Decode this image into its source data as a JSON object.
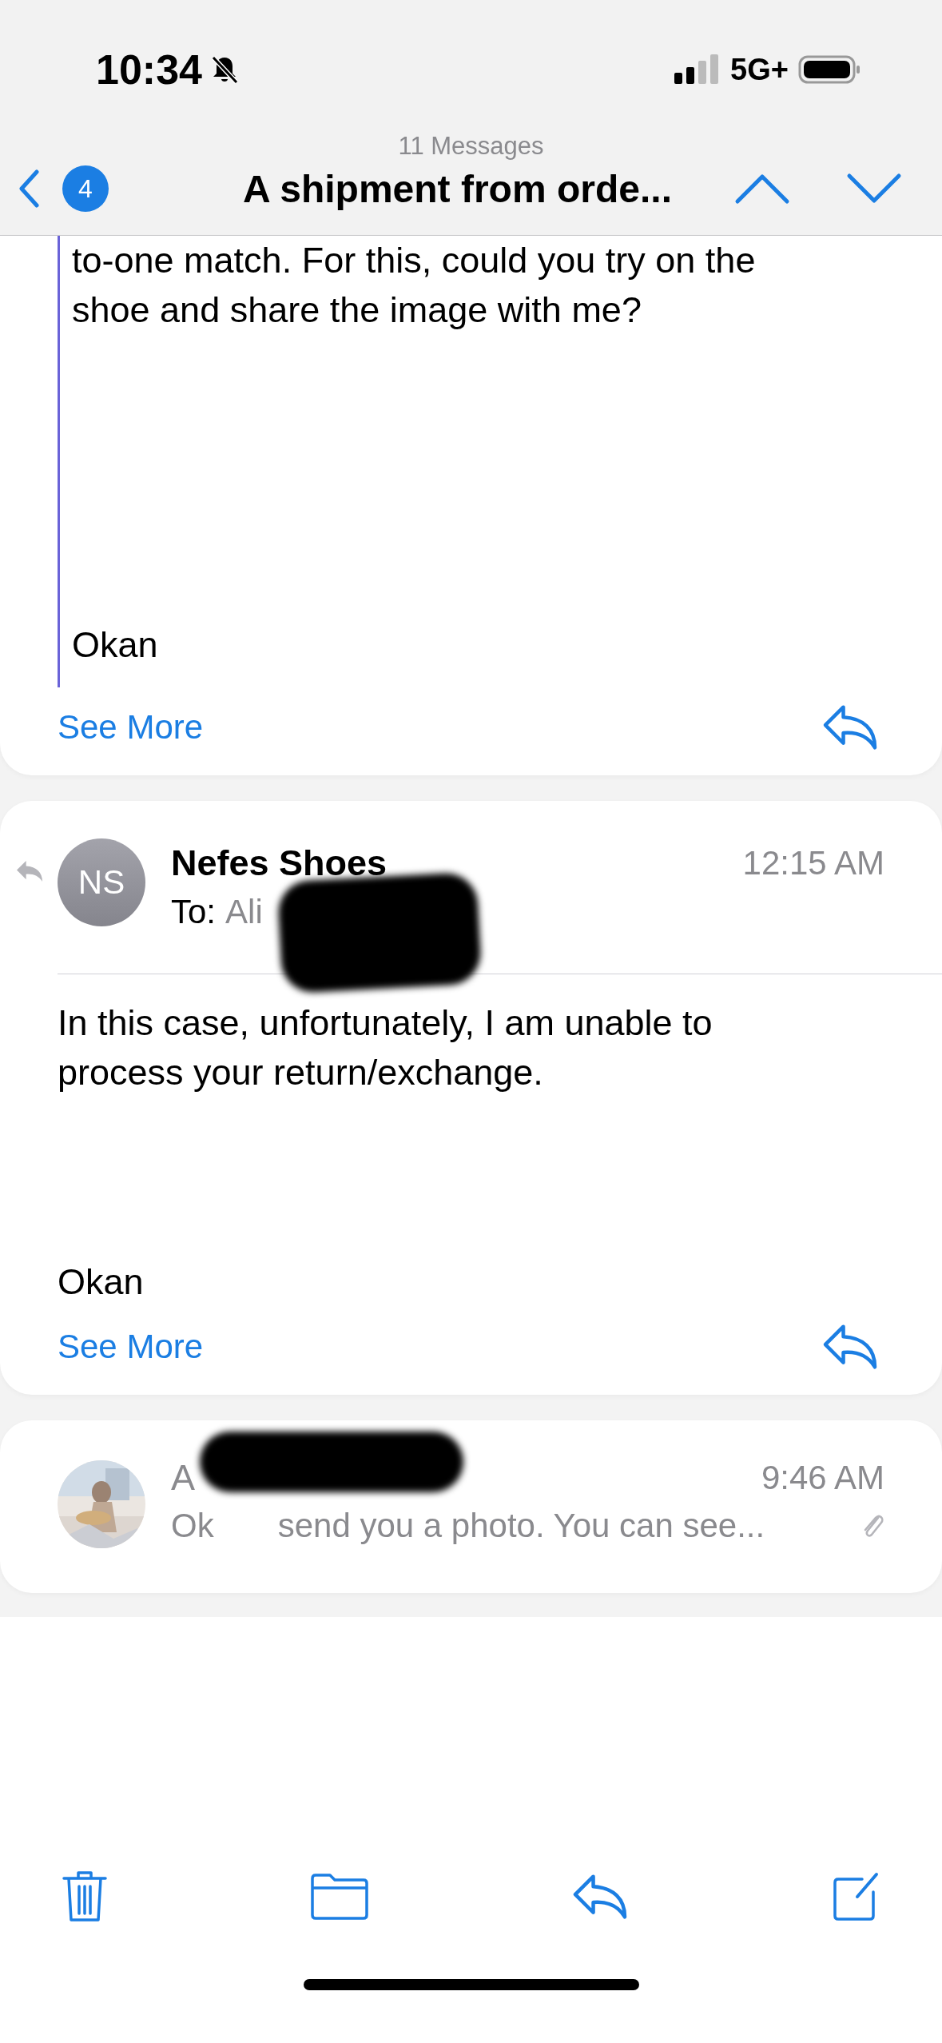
{
  "status_bar": {
    "time": "10:34",
    "network": "5G+",
    "silent": true
  },
  "nav": {
    "back_count": "4",
    "subtitle": "11 Messages",
    "title": "A shipment from orde..."
  },
  "messages": [
    {
      "kind": "continued",
      "quoted": true,
      "body_lines": [
        "to-one match. For this, could you try on the",
        "shoe and share the image with me?"
      ],
      "signature": "Okan",
      "see_more": "See More"
    },
    {
      "kind": "full",
      "replied": true,
      "avatar": {
        "kind": "initials",
        "text": "NS"
      },
      "sender": "Nefes Shoes",
      "to_label": "To:",
      "recipient": "Ali",
      "time": "12:15 AM",
      "redacted": true,
      "body_lines": [
        "In this case, unfortunately, I am unable to",
        "process your return/exchange."
      ],
      "signature": "Okan",
      "see_more": "See More"
    },
    {
      "kind": "collapsed",
      "sender": "A",
      "time": "9:46 AM",
      "preview_start": "Ok",
      "preview_end": "send you a photo. You can see...",
      "attachment": true,
      "redacted": true
    }
  ]
}
